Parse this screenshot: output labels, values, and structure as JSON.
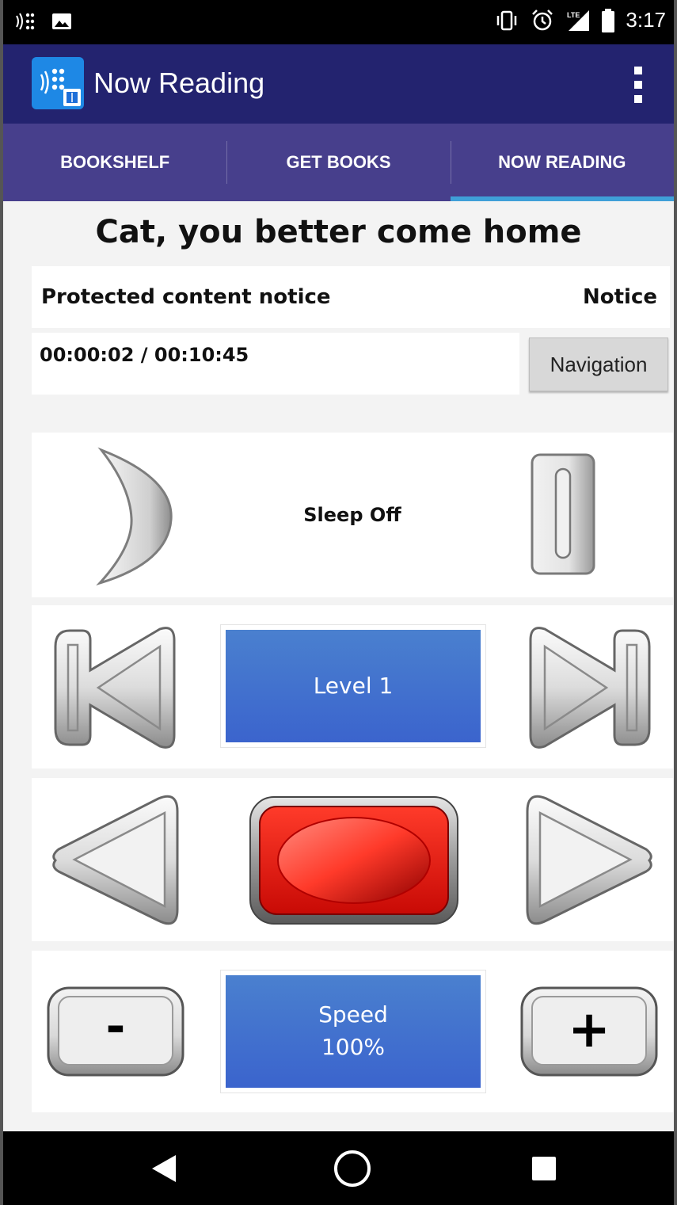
{
  "status_bar": {
    "time": "3:17",
    "network_label": "LTE"
  },
  "app_bar": {
    "title": "Now Reading",
    "overflow_icon": "overflow-menu-icon",
    "logo_icon": "app-logo-icon"
  },
  "tabs": [
    {
      "label": "BOOKSHELF",
      "active": false
    },
    {
      "label": "GET BOOKS",
      "active": false
    },
    {
      "label": "NOW READING",
      "active": true
    }
  ],
  "book": {
    "title": "Cat, you better come home"
  },
  "notice": {
    "text": "Protected content notice",
    "link": "Notice"
  },
  "playback": {
    "time": "00:00:02 / 00:10:45",
    "navigation_label": "Navigation"
  },
  "sleep": {
    "label": "Sleep Off"
  },
  "level": {
    "label": "Level 1"
  },
  "speed": {
    "label": "Speed",
    "value": "100%"
  },
  "decrease": {
    "label": "-"
  },
  "increase": {
    "label": "+"
  },
  "colors": {
    "appbar": "#23236f",
    "tabs": "#473f8c",
    "tab_indicator": "#3f9fd8",
    "blue_button": "#3b64cd",
    "play_button": "#e8130c"
  }
}
